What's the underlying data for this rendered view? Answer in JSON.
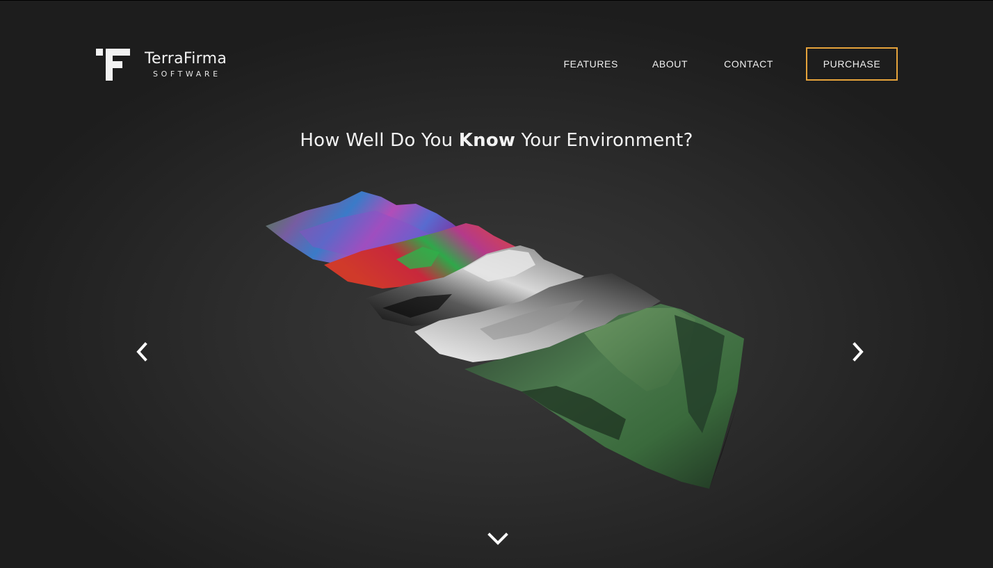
{
  "brand": {
    "name": "TerraFirma",
    "subtitle": "SOFTWARE"
  },
  "nav": {
    "features": "FEATURES",
    "about": "ABOUT",
    "contact": "CONTACT",
    "purchase": "PURCHASE"
  },
  "hero": {
    "headline_before": "How Well Do You ",
    "headline_emphasis": "Know",
    "headline_after": " Your Environment?"
  },
  "carousel": {
    "prev_icon": "chevron-left-icon",
    "next_icon": "chevron-right-icon",
    "scroll_icon": "chevron-down-icon"
  },
  "colors": {
    "accent": "#e6a33b",
    "background": "#1e1e1e",
    "text": "#ffffff"
  }
}
